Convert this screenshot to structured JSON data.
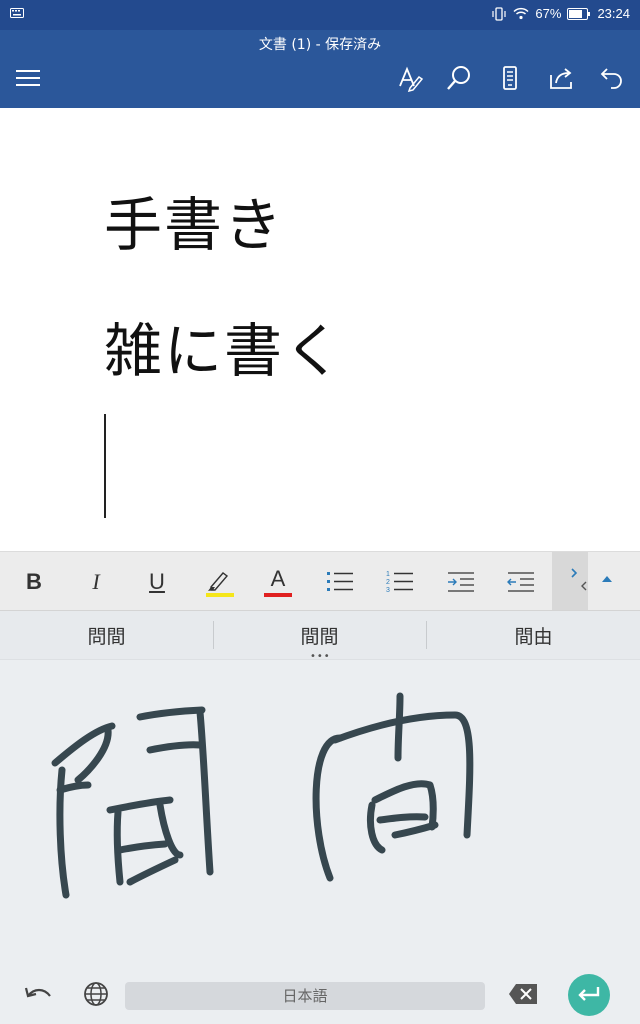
{
  "status": {
    "keyboard_icon": "keyboard-icon",
    "battery_percent": "67%",
    "time": "23:24"
  },
  "appbar": {
    "title": "文書 (1) - 保存済み",
    "icons": [
      "menu-icon",
      "pen-icon",
      "search-icon",
      "mobile-view-icon",
      "share-icon",
      "undo-icon"
    ],
    "color": "#2b579a"
  },
  "document": {
    "lines": [
      "手書き",
      "雑に書く"
    ]
  },
  "ribbon": {
    "bold": "B",
    "italic": "I",
    "underline": "U",
    "font_color": "A",
    "highlight_color": "#f5e61a",
    "font_color_bar": "#e02020"
  },
  "candidates": [
    "問間",
    "間間",
    "間由"
  ],
  "keyboard": {
    "space_label": "日本語",
    "enter_color": "#3eb7a5"
  }
}
